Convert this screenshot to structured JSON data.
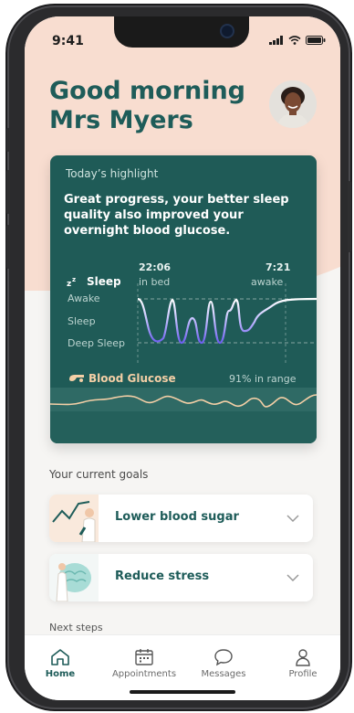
{
  "status_bar": {
    "time": "9:41"
  },
  "greeting": {
    "line1": "Good morning",
    "line2": "Mrs Myers"
  },
  "highlight": {
    "kicker": "Today’s highlight",
    "headline": "Great progress, your better sleep quality also improved your overnight blood glucose.",
    "sleep_label": "Sleep",
    "bed_time": "22:06",
    "bed_caption": "in bed",
    "wake_time": "7:21",
    "wake_caption": "awake",
    "stages": [
      "Awake",
      "Sleep",
      "Deep Sleep"
    ],
    "glucose_label": "Blood Glucose",
    "glucose_range": "91% in range",
    "colors": {
      "card": "#1f5b57",
      "sleep_line": "#7b6cf2",
      "glucose_line": "#f4cfa6"
    }
  },
  "goals": {
    "title": "Your current goals",
    "items": [
      {
        "label": "Lower blood sugar",
        "icon": "chart-person-illustration"
      },
      {
        "label": "Reduce stress",
        "icon": "brain-person-illustration"
      }
    ]
  },
  "next_steps": {
    "title": "Next steps"
  },
  "tabs": [
    {
      "label": "Home",
      "icon": "home-icon",
      "active": true
    },
    {
      "label": "Appointments",
      "icon": "calendar-icon",
      "active": false
    },
    {
      "label": "Messages",
      "icon": "chat-bubble-icon",
      "active": false
    },
    {
      "label": "Profile",
      "icon": "person-icon",
      "active": false
    }
  ]
}
